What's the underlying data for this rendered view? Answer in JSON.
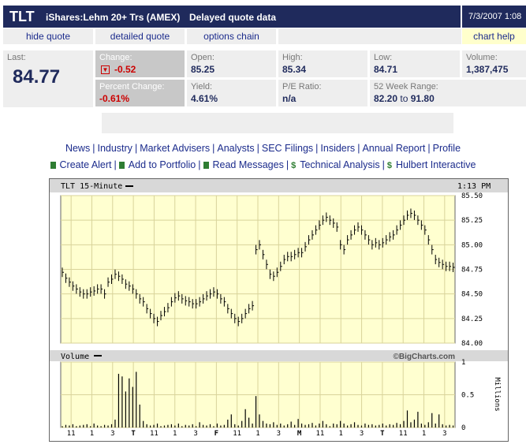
{
  "header": {
    "symbol": "TLT",
    "name": "iShares:Lehm 20+ Trs (AMEX)",
    "delayed": "Delayed quote data",
    "datetime": "7/3/2007 1:08"
  },
  "nav": {
    "hide_quote": "hide quote",
    "detailed_quote": "detailed quote",
    "options_chain": "options chain",
    "chart_help": "chart help"
  },
  "quote": {
    "last_label": "Last:",
    "last": "84.77",
    "change_label": "Change:",
    "change": "-0.52",
    "pct_label": "Percent Change:",
    "pct": "-0.61%",
    "open_label": "Open:",
    "open": "85.25",
    "high_label": "High:",
    "high": "85.34",
    "low_label": "Low:",
    "low": "84.71",
    "volume_label": "Volume:",
    "volume": "1,387,475",
    "yield_label": "Yield:",
    "yield": "4.61%",
    "pe_label": "P/E Ratio:",
    "pe": "n/a",
    "range_label": "52 Week Range:",
    "range_low": "82.20",
    "range_to": "to",
    "range_high": "91.80"
  },
  "links1": [
    "News",
    "Industry",
    "Market Advisers",
    "Analysts",
    "SEC Filings",
    "Insiders",
    "Annual Report",
    "Profile"
  ],
  "links2": [
    "Create Alert",
    "Add to Portfolio",
    "Read Messages",
    "Technical Analysis",
    "Hulbert Interactive"
  ],
  "chart_data": {
    "type": "line",
    "title": "TLT 15-Minute",
    "time_label": "1:13 PM",
    "credit": "©BigCharts.com",
    "volume_label": "Volume",
    "volume_unit": "Millions",
    "price_ticks": [
      "85.50",
      "85.25",
      "85.00",
      "84.75",
      "84.50",
      "84.25",
      "84.00"
    ],
    "price_range": [
      84.0,
      85.5
    ],
    "volume_ticks": [
      "1",
      "0.5",
      "0"
    ],
    "volume_range": [
      0,
      1
    ],
    "x_ticks": [
      "11",
      "1",
      "3",
      "T",
      "11",
      "1",
      "3",
      "F",
      "11",
      "1",
      "3",
      "M",
      "11",
      "1",
      "3",
      "T",
      "11",
      "1",
      "3"
    ],
    "bold_ticks": [
      "T",
      "F",
      "M"
    ],
    "grid": true,
    "price": [
      84.72,
      84.66,
      84.62,
      84.58,
      84.55,
      84.52,
      84.5,
      84.5,
      84.52,
      84.53,
      84.55,
      84.55,
      84.5,
      84.62,
      84.65,
      84.7,
      84.68,
      84.65,
      84.6,
      84.58,
      84.55,
      84.5,
      84.45,
      84.42,
      84.35,
      84.3,
      84.25,
      84.22,
      84.28,
      84.32,
      84.36,
      84.42,
      84.46,
      84.48,
      84.45,
      84.43,
      84.42,
      84.4,
      84.4,
      84.42,
      84.45,
      84.48,
      84.5,
      84.52,
      84.5,
      84.45,
      84.42,
      84.35,
      84.3,
      84.25,
      84.22,
      84.25,
      84.3,
      84.35,
      84.38,
      84.95,
      85.0,
      84.9,
      84.8,
      84.7,
      84.68,
      84.72,
      84.78,
      84.85,
      84.88,
      84.88,
      84.9,
      84.92,
      84.92,
      84.98,
      85.05,
      85.1,
      85.15,
      85.2,
      85.25,
      85.28,
      85.25,
      85.22,
      85.18,
      85.0,
      84.95,
      85.05,
      85.1,
      85.15,
      85.18,
      85.15,
      85.1,
      85.05,
      85.0,
      85.02,
      85.0,
      85.02,
      85.05,
      85.08,
      85.1,
      85.15,
      85.2,
      85.25,
      85.3,
      85.32,
      85.3,
      85.25,
      85.2,
      85.15,
      85.05,
      84.95,
      84.85,
      84.82,
      84.8,
      84.78,
      84.78,
      84.77
    ],
    "volume": [
      0.02,
      0.04,
      0.03,
      0.05,
      0.02,
      0.03,
      0.04,
      0.05,
      0.02,
      0.06,
      0.03,
      0.02,
      0.04,
      0.03,
      0.05,
      0.12,
      0.82,
      0.78,
      0.55,
      0.75,
      0.62,
      0.85,
      0.35,
      0.1,
      0.05,
      0.03,
      0.04,
      0.06,
      0.02,
      0.03,
      0.04,
      0.05,
      0.03,
      0.06,
      0.02,
      0.04,
      0.03,
      0.05,
      0.02,
      0.08,
      0.04,
      0.03,
      0.05,
      0.02,
      0.06,
      0.03,
      0.04,
      0.12,
      0.2,
      0.05,
      0.03,
      0.1,
      0.28,
      0.15,
      0.06,
      0.48,
      0.2,
      0.1,
      0.06,
      0.05,
      0.08,
      0.04,
      0.06,
      0.03,
      0.05,
      0.09,
      0.04,
      0.13,
      0.06,
      0.04,
      0.05,
      0.07,
      0.03,
      0.06,
      0.1,
      0.05,
      0.02,
      0.06,
      0.05,
      0.1,
      0.06,
      0.03,
      0.05,
      0.08,
      0.04,
      0.03,
      0.06,
      0.04,
      0.05,
      0.03,
      0.04,
      0.06,
      0.03,
      0.05,
      0.04,
      0.07,
      0.05,
      0.1,
      0.26,
      0.08,
      0.12,
      0.24,
      0.06,
      0.04,
      0.08,
      0.22,
      0.06,
      0.2,
      0.05,
      0.03,
      0.04,
      0.03
    ]
  }
}
